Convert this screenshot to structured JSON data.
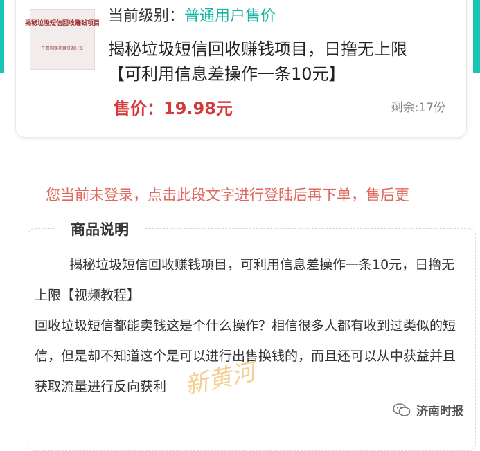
{
  "product": {
    "thumbnail": {
      "title": "揭秘垃圾短信回收赚钱项目",
      "subtitle": "牛哥网赚项目资源分享"
    },
    "level_label": "当前级别：",
    "level_value": "普通用户售价",
    "title": "揭秘垃圾短信回收赚钱项目，日撸无上限【可利用信息差操作一条10元】",
    "price": "售价：19.98元",
    "stock": "剩余:17份"
  },
  "notice": "您当前未登录，点击此段文字进行登陆后再下单，售后更",
  "description": {
    "heading": "商品说明",
    "paragraphs": [
      "揭秘垃圾短信回收赚钱项目，可利用信息差操作一条10元，日撸无上限【视频教程】",
      "回收垃圾短信都能卖钱这是个什么操作？相信很多人都有收到过类似的短信，但是却不知道这个是可以进行出售换钱的，而且还可以从中获益并且获取流量进行反向获利"
    ]
  },
  "watermark": "新黄河",
  "brand": {
    "name": "济南时报",
    "icon": "wechat-icon"
  },
  "colors": {
    "accent": "#19c6b5",
    "price": "#d6393a",
    "notice": "#e0685e"
  }
}
